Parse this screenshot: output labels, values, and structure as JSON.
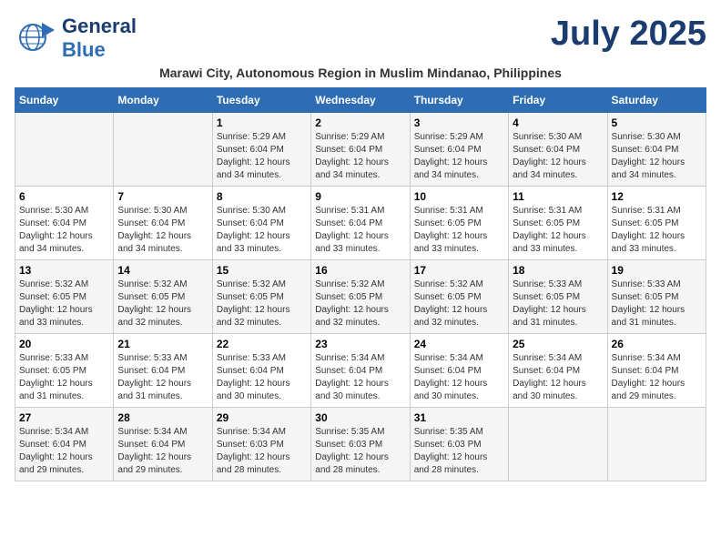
{
  "header": {
    "logo_general": "General",
    "logo_blue": "Blue",
    "month_title": "July 2025",
    "subtitle": "Marawi City, Autonomous Region in Muslim Mindanao, Philippines"
  },
  "days_of_week": [
    "Sunday",
    "Monday",
    "Tuesday",
    "Wednesday",
    "Thursday",
    "Friday",
    "Saturday"
  ],
  "weeks": [
    [
      {
        "day": "",
        "info": ""
      },
      {
        "day": "",
        "info": ""
      },
      {
        "day": "1",
        "info": "Sunrise: 5:29 AM\nSunset: 6:04 PM\nDaylight: 12 hours and 34 minutes."
      },
      {
        "day": "2",
        "info": "Sunrise: 5:29 AM\nSunset: 6:04 PM\nDaylight: 12 hours and 34 minutes."
      },
      {
        "day": "3",
        "info": "Sunrise: 5:29 AM\nSunset: 6:04 PM\nDaylight: 12 hours and 34 minutes."
      },
      {
        "day": "4",
        "info": "Sunrise: 5:30 AM\nSunset: 6:04 PM\nDaylight: 12 hours and 34 minutes."
      },
      {
        "day": "5",
        "info": "Sunrise: 5:30 AM\nSunset: 6:04 PM\nDaylight: 12 hours and 34 minutes."
      }
    ],
    [
      {
        "day": "6",
        "info": "Sunrise: 5:30 AM\nSunset: 6:04 PM\nDaylight: 12 hours and 34 minutes."
      },
      {
        "day": "7",
        "info": "Sunrise: 5:30 AM\nSunset: 6:04 PM\nDaylight: 12 hours and 34 minutes."
      },
      {
        "day": "8",
        "info": "Sunrise: 5:30 AM\nSunset: 6:04 PM\nDaylight: 12 hours and 33 minutes."
      },
      {
        "day": "9",
        "info": "Sunrise: 5:31 AM\nSunset: 6:04 PM\nDaylight: 12 hours and 33 minutes."
      },
      {
        "day": "10",
        "info": "Sunrise: 5:31 AM\nSunset: 6:05 PM\nDaylight: 12 hours and 33 minutes."
      },
      {
        "day": "11",
        "info": "Sunrise: 5:31 AM\nSunset: 6:05 PM\nDaylight: 12 hours and 33 minutes."
      },
      {
        "day": "12",
        "info": "Sunrise: 5:31 AM\nSunset: 6:05 PM\nDaylight: 12 hours and 33 minutes."
      }
    ],
    [
      {
        "day": "13",
        "info": "Sunrise: 5:32 AM\nSunset: 6:05 PM\nDaylight: 12 hours and 33 minutes."
      },
      {
        "day": "14",
        "info": "Sunrise: 5:32 AM\nSunset: 6:05 PM\nDaylight: 12 hours and 32 minutes."
      },
      {
        "day": "15",
        "info": "Sunrise: 5:32 AM\nSunset: 6:05 PM\nDaylight: 12 hours and 32 minutes."
      },
      {
        "day": "16",
        "info": "Sunrise: 5:32 AM\nSunset: 6:05 PM\nDaylight: 12 hours and 32 minutes."
      },
      {
        "day": "17",
        "info": "Sunrise: 5:32 AM\nSunset: 6:05 PM\nDaylight: 12 hours and 32 minutes."
      },
      {
        "day": "18",
        "info": "Sunrise: 5:33 AM\nSunset: 6:05 PM\nDaylight: 12 hours and 31 minutes."
      },
      {
        "day": "19",
        "info": "Sunrise: 5:33 AM\nSunset: 6:05 PM\nDaylight: 12 hours and 31 minutes."
      }
    ],
    [
      {
        "day": "20",
        "info": "Sunrise: 5:33 AM\nSunset: 6:05 PM\nDaylight: 12 hours and 31 minutes."
      },
      {
        "day": "21",
        "info": "Sunrise: 5:33 AM\nSunset: 6:04 PM\nDaylight: 12 hours and 31 minutes."
      },
      {
        "day": "22",
        "info": "Sunrise: 5:33 AM\nSunset: 6:04 PM\nDaylight: 12 hours and 30 minutes."
      },
      {
        "day": "23",
        "info": "Sunrise: 5:34 AM\nSunset: 6:04 PM\nDaylight: 12 hours and 30 minutes."
      },
      {
        "day": "24",
        "info": "Sunrise: 5:34 AM\nSunset: 6:04 PM\nDaylight: 12 hours and 30 minutes."
      },
      {
        "day": "25",
        "info": "Sunrise: 5:34 AM\nSunset: 6:04 PM\nDaylight: 12 hours and 30 minutes."
      },
      {
        "day": "26",
        "info": "Sunrise: 5:34 AM\nSunset: 6:04 PM\nDaylight: 12 hours and 29 minutes."
      }
    ],
    [
      {
        "day": "27",
        "info": "Sunrise: 5:34 AM\nSunset: 6:04 PM\nDaylight: 12 hours and 29 minutes."
      },
      {
        "day": "28",
        "info": "Sunrise: 5:34 AM\nSunset: 6:04 PM\nDaylight: 12 hours and 29 minutes."
      },
      {
        "day": "29",
        "info": "Sunrise: 5:34 AM\nSunset: 6:03 PM\nDaylight: 12 hours and 28 minutes."
      },
      {
        "day": "30",
        "info": "Sunrise: 5:35 AM\nSunset: 6:03 PM\nDaylight: 12 hours and 28 minutes."
      },
      {
        "day": "31",
        "info": "Sunrise: 5:35 AM\nSunset: 6:03 PM\nDaylight: 12 hours and 28 minutes."
      },
      {
        "day": "",
        "info": ""
      },
      {
        "day": "",
        "info": ""
      }
    ]
  ]
}
